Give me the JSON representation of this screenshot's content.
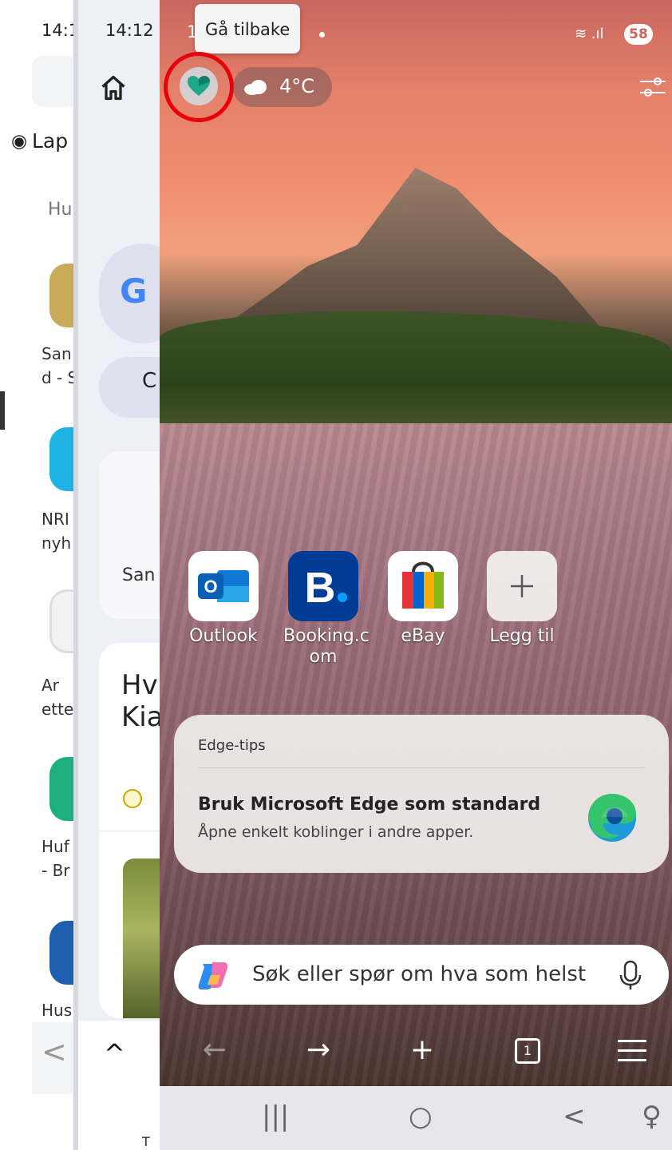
{
  "win1": {
    "time": "14:1",
    "tab_label": "Lap",
    "section_header": "Hu",
    "apps": [
      {
        "label": "San\nd - S",
        "color": "#c9aa59"
      },
      {
        "label": "NRI\nnyh",
        "color": "#1fb2e5"
      },
      {
        "label": "Ar\nette",
        "color": "#ffffff"
      },
      {
        "label": "Huf\n- Br",
        "color": "#1fae7e"
      },
      {
        "label": "Hus",
        "color": "#1d5fae"
      }
    ],
    "back_glyph": "<"
  },
  "win2": {
    "time": "14:12",
    "google_letter": "G",
    "pill_text": "C",
    "card_text": "San",
    "headline": "Hv\nKia",
    "caret": "^",
    "bottom_text": "T"
  },
  "main": {
    "status": {
      "time": "1",
      "signal": "≋ .ıl",
      "battery": "58"
    },
    "tooltip": "Gå tilbake",
    "weather": {
      "temp": "4°C"
    },
    "quick_links": [
      {
        "label": "Outlook"
      },
      {
        "label": "Booking.c\nom"
      },
      {
        "label": "eBay"
      },
      {
        "label": "Legg til"
      }
    ],
    "tips": {
      "title": "Edge-tips",
      "heading": "Bruk Microsoft Edge som standard",
      "subtitle": "Åpne enkelt koblinger i andre apper."
    },
    "search": {
      "placeholder": "Søk eller spør om hva som helst"
    },
    "toolbar": {
      "back": "←",
      "forward": "→",
      "new_tab": "+",
      "tab_count": "1"
    },
    "nav": {
      "recents": "|||",
      "home": "○",
      "back": "<",
      "accessibility": "♀"
    }
  }
}
